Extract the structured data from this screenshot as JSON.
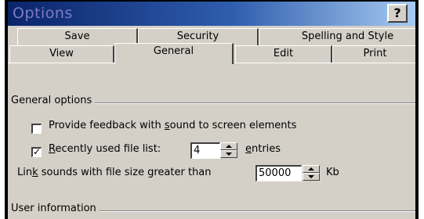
{
  "window": {
    "title": "Options",
    "help_label": "?"
  },
  "tabs_back": [
    "Save",
    "Security",
    "Spelling and Style"
  ],
  "tabs_front": [
    "View",
    "General",
    "Edit",
    "Print"
  ],
  "active_tab": "General",
  "general_options": {
    "group_title": "General options",
    "feedback_sound": {
      "pre": "Provide feedback with ",
      "key": "s",
      "post": "ound to screen elements",
      "checked": false
    },
    "recent_files": {
      "key": "R",
      "post": "ecently used file list:",
      "value": "4",
      "suffix_key": "e",
      "suffix_post": "ntries",
      "checked": true,
      "check_glyph": "✓"
    },
    "link_sounds": {
      "pre": "Lin",
      "key": "k",
      "post": " sounds with file size greater than",
      "value": "50000",
      "unit": "Kb"
    }
  },
  "user_information": {
    "group_title": "User information"
  }
}
